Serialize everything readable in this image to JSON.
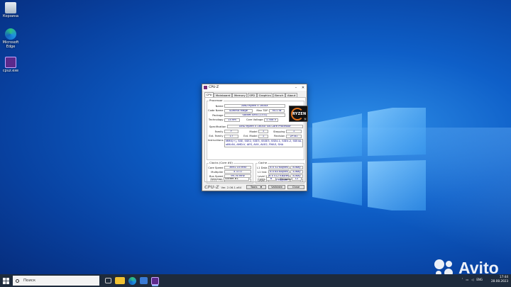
{
  "desktop": {
    "icons": [
      {
        "name": "recycle-bin",
        "label": "Корзина"
      },
      {
        "name": "microsoft-edge",
        "label": "Microsoft Edge"
      },
      {
        "name": "cpuz-shortcut",
        "label": "cpuz.exe"
      }
    ]
  },
  "window": {
    "title": "CPU-Z",
    "tabs": [
      "CPU",
      "Mainboard",
      "Memory",
      "SPD",
      "Graphics",
      "Bench",
      "About"
    ],
    "active_tab": "CPU"
  },
  "processor": {
    "group_label": "Processor",
    "name_label": "Name",
    "name": "AMD Ryzen 5 1600X",
    "code_name_label": "Code Name",
    "code_name": "Summit Ridge",
    "max_tdp_label": "Max TDP",
    "max_tdp": "95.0 W",
    "package_label": "Package",
    "package": "Socket AM4 (1331)",
    "technology_label": "Technology",
    "technology": "14 nm",
    "core_voltage_label": "Core Voltage",
    "core_voltage": "1.308 V",
    "specification_label": "Specification",
    "specification": "AMD Ryzen 5 1600X Six-Core Processor",
    "family_label": "Family",
    "family": "F",
    "model_label": "Model",
    "model": "1",
    "stepping_label": "Stepping",
    "stepping": "1",
    "ext_family_label": "Ext. Family",
    "ext_family": "17",
    "ext_model_label": "Ext. Model",
    "ext_model": "1",
    "revision_label": "Revision",
    "revision": "ZP-B1",
    "instructions_label": "Instructions",
    "instructions": "MMX(+), SSE, SSE2, SSE3, SSSE3, SSE4.1, SSE4.2, SSE4A, x86-64, AMD-V, AES, AVX, AVX2, FMA3, SHA",
    "logo_text": "RYZEN",
    "logo_badge": "5"
  },
  "clocks": {
    "group_label": "Clocks (Core #0)",
    "core_speed_label": "Core Speed",
    "core_speed": "3691.10 MHz",
    "multiplier_label": "Multiplier",
    "multiplier": "x 37.0",
    "bus_speed_label": "Bus Speed",
    "bus_speed": "99.76 MHz",
    "rated_fsb_label": "Rated FSB",
    "rated_fsb": ""
  },
  "cache": {
    "group_label": "Cache",
    "l1_data_label": "L1 Data",
    "l1_data": "6 x 32 KBytes",
    "l1_data_way": "8-way",
    "l1_inst_label": "L1 Inst.",
    "l1_inst": "6 x 64 KBytes",
    "l1_inst_way": "4-way",
    "level2_label": "Level 2",
    "level2": "6 x 512 KBytes",
    "level2_way": "8-way",
    "level3_label": "Level 3",
    "level3": "2 x 8 MBytes",
    "level3_way": "16-way"
  },
  "selection": {
    "selection_label": "Selection",
    "selection_value": "Socket #1",
    "cores_label": "Cores",
    "cores": "6",
    "threads_label": "Threads",
    "threads": "12"
  },
  "footer": {
    "brand": "CPU-Z",
    "version": "Ver. 2.06.1.x64",
    "tools_label": "Tools",
    "validate_label": "Validate",
    "close_label": "Close"
  },
  "taskbar": {
    "search_placeholder": "Поиск",
    "language": "ENG",
    "time": "17:44",
    "date": "28.08.2023"
  },
  "watermark": {
    "text": "Avito"
  },
  "colors": {
    "value_text": "#000080",
    "taskbar_bg": "#1e2b3c",
    "desktop_bg": "#0e5fc8"
  }
}
